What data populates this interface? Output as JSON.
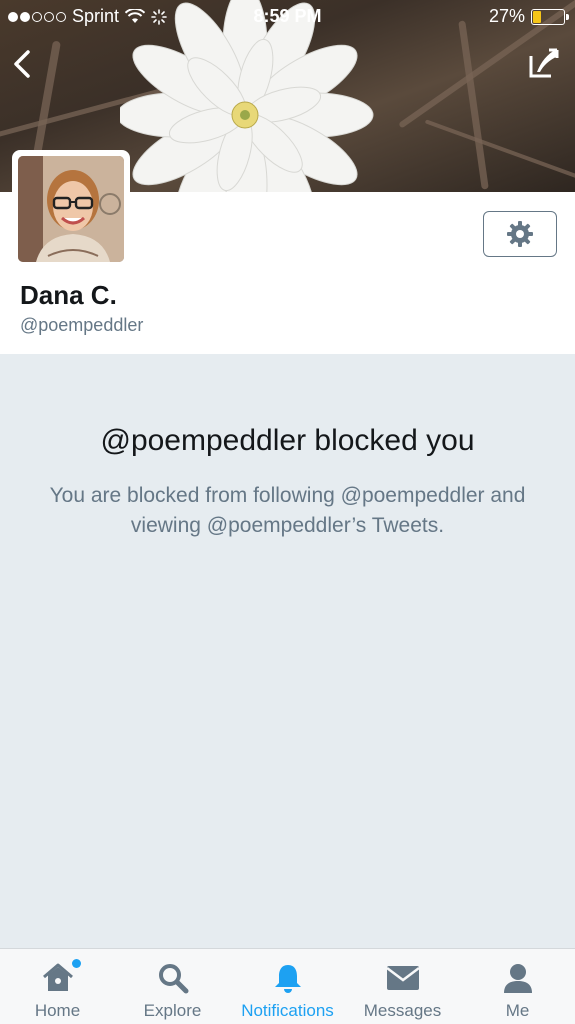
{
  "status_bar": {
    "carrier": "Sprint",
    "time": "8:59 PM",
    "battery_percent": "27%",
    "battery_level": 0.27,
    "signal_filled": 2,
    "signal_total": 5
  },
  "profile": {
    "display_name": "Dana C.",
    "handle": "@poempeddler"
  },
  "blocked": {
    "title": "@poempeddler blocked you",
    "description": "You are blocked from following @poempeddler and viewing @poempeddler’s Tweets."
  },
  "tabs": [
    {
      "label": "Home",
      "icon": "home-icon",
      "active": false,
      "badge": true
    },
    {
      "label": "Explore",
      "icon": "search-icon",
      "active": false,
      "badge": false
    },
    {
      "label": "Notifications",
      "icon": "bell-icon",
      "active": true,
      "badge": false
    },
    {
      "label": "Messages",
      "icon": "envelope-icon",
      "active": false,
      "badge": false
    },
    {
      "label": "Me",
      "icon": "person-icon",
      "active": false,
      "badge": false
    }
  ],
  "colors": {
    "accent": "#1da1f2",
    "muted": "#657786",
    "background": "#e6ecf0",
    "battery": "#f5c518"
  }
}
